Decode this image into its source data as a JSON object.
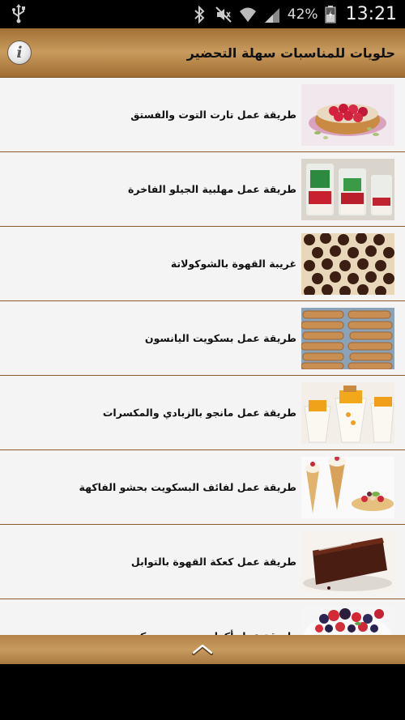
{
  "status_bar": {
    "battery_percent": "42%",
    "time": "13:21",
    "icons": [
      "usb-icon",
      "bluetooth-icon",
      "mute-icon",
      "wifi-icon",
      "signal-icon",
      "battery-icon"
    ]
  },
  "app_bar": {
    "title": "حلويات للمناسبات سهلة التحضير",
    "info_icon": "info-icon",
    "info_glyph": "i"
  },
  "recipes": [
    {
      "title": "طريقة عمل تارت التوت والفستق",
      "thumb": "raspberry-tart-photo"
    },
    {
      "title": "طريقة عمل مهلبية الجيلو الفاخرة",
      "thumb": "jello-cups-photo"
    },
    {
      "title": "غريبة القهوة بالشوكولاتة",
      "thumb": "chocolate-cookies-photo"
    },
    {
      "title": "طريقة عمل بسكويت اليانسون",
      "thumb": "anise-biscuits-photo"
    },
    {
      "title": "طريقة عمل مانجو بالزبادي والمكسرات",
      "thumb": "mango-yogurt-photo"
    },
    {
      "title": "طريقة عمل لفائف البسكويت بحشو الفاكهة",
      "thumb": "biscuit-cones-photo"
    },
    {
      "title": "طريقة عمل كعكة القهوة بالتوابل",
      "thumb": "coffee-cake-photo"
    },
    {
      "title": "طريقة عمل أكواب توت مع بسكويت",
      "thumb": "berry-cups-photo"
    }
  ],
  "bottom_bar": {
    "icon": "chevron-up-icon"
  },
  "colors": {
    "header": "#b98a4f",
    "divider": "#8a5a2b",
    "list_bg": "#f4f4f4"
  }
}
